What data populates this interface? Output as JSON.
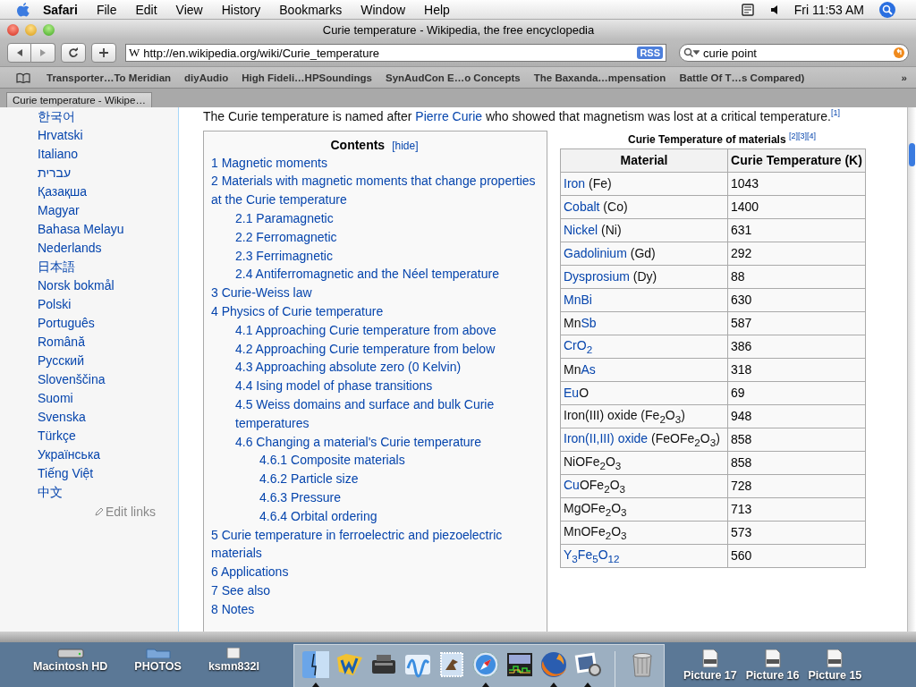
{
  "menubar": {
    "app": "Safari",
    "menus": [
      "File",
      "Edit",
      "View",
      "History",
      "Bookmarks",
      "Window",
      "Help"
    ],
    "clock": "Fri 11:53 AM"
  },
  "window": {
    "title": "Curie temperature - Wikipedia, the free encyclopedia"
  },
  "toolbar": {
    "favicon": "W",
    "url": "http://en.wikipedia.org/wiki/Curie_temperature",
    "rss": "RSS",
    "search": "curie point"
  },
  "bookmarks": {
    "items": [
      "Transporter…To Meridian",
      "diyAudio",
      "High Fideli…HPSoundings",
      "SynAudCon E…o Concepts",
      "The Baxanda…mpensation",
      "Battle Of T…s Compared)"
    ],
    "overflow": "»"
  },
  "tabs": [
    {
      "label": "Curie temperature - Wikipe…",
      "selected": true
    }
  ],
  "sidebar": {
    "languages": [
      "한국어",
      "Hrvatski",
      "Italiano",
      "עברית",
      "Қазақша",
      "Magyar",
      "Bahasa Melayu",
      "Nederlands",
      "日本語",
      "Norsk bokmål",
      "Polski",
      "Português",
      "Română",
      "Русский",
      "Slovenščina",
      "Suomi",
      "Svenska",
      "Türkçe",
      "Українська",
      "Tiếng Việt",
      "中文"
    ],
    "edit_links": "Edit links"
  },
  "intro": {
    "before": "The Curie temperature is named after ",
    "link": "Pierre Curie",
    "after": " who showed that magnetism was lost at a critical temperature.",
    "ref": "[1]"
  },
  "contents": {
    "title": "Contents",
    "toggle": "[hide]",
    "items": [
      {
        "number": "1",
        "label": "Magnetic moments"
      },
      {
        "number": "2",
        "label": "Materials with magnetic moments that change properties at the Curie temperature",
        "children": [
          {
            "number": "2.1",
            "label": "Paramagnetic"
          },
          {
            "number": "2.2",
            "label": "Ferromagnetic"
          },
          {
            "number": "2.3",
            "label": "Ferrimagnetic"
          },
          {
            "number": "2.4",
            "label": "Antiferromagnetic and the Néel temperature"
          }
        ]
      },
      {
        "number": "3",
        "label": "Curie-Weiss law"
      },
      {
        "number": "4",
        "label": "Physics of Curie temperature",
        "children": [
          {
            "number": "4.1",
            "label": "Approaching Curie temperature from above"
          },
          {
            "number": "4.2",
            "label": "Approaching Curie temperature from below"
          },
          {
            "number": "4.3",
            "label": "Approaching absolute zero (0 Kelvin)"
          },
          {
            "number": "4.4",
            "label": "Ising model of phase transitions"
          },
          {
            "number": "4.5",
            "label": "Weiss domains and surface and bulk Curie temperatures"
          },
          {
            "number": "4.6",
            "label": "Changing a material's Curie temperature",
            "children": [
              {
                "number": "4.6.1",
                "label": "Composite materials"
              },
              {
                "number": "4.6.2",
                "label": "Particle size"
              },
              {
                "number": "4.6.3",
                "label": "Pressure"
              },
              {
                "number": "4.6.4",
                "label": "Orbital ordering"
              }
            ]
          }
        ]
      },
      {
        "number": "5",
        "label": "Curie temperature in ferroelectric and piezoelectric materials"
      },
      {
        "number": "6",
        "label": "Applications"
      },
      {
        "number": "7",
        "label": "See also"
      },
      {
        "number": "8",
        "label": "Notes"
      }
    ]
  },
  "table": {
    "caption": "Curie Temperature of materials",
    "caption_refs": "[2][3][4]",
    "columns": [
      "Material",
      "Curie Temperature (K)"
    ],
    "rows": [
      {
        "material": [
          {
            "text": "Iron",
            "link": true
          },
          {
            "text": " (Fe)",
            "link": false
          }
        ],
        "temperature": "1043"
      },
      {
        "material": [
          {
            "text": "Cobalt",
            "link": true
          },
          {
            "text": " (Co)",
            "link": false
          }
        ],
        "temperature": "1400"
      },
      {
        "material": [
          {
            "text": "Nickel",
            "link": true
          },
          {
            "text": " (Ni)",
            "link": false
          }
        ],
        "temperature": "631"
      },
      {
        "material": [
          {
            "text": "Gadolinium",
            "link": true
          },
          {
            "text": " (Gd)",
            "link": false
          }
        ],
        "temperature": "292"
      },
      {
        "material": [
          {
            "text": "Dysprosium",
            "link": true
          },
          {
            "text": " (Dy)",
            "link": false
          }
        ],
        "temperature": "88"
      },
      {
        "material": [
          {
            "text": "MnBi",
            "link": true
          }
        ],
        "temperature": "630"
      },
      {
        "material": [
          {
            "text": "Mn",
            "link": false
          },
          {
            "text": "Sb",
            "link": true
          }
        ],
        "temperature": "587"
      },
      {
        "material": [
          {
            "text": "CrO$_{2}$",
            "link": true
          }
        ],
        "temperature": "386"
      },
      {
        "material": [
          {
            "text": "Mn",
            "link": false
          },
          {
            "text": "As",
            "link": true
          }
        ],
        "temperature": "318"
      },
      {
        "material": [
          {
            "text": "Eu",
            "link": true
          },
          {
            "text": "O",
            "link": false
          }
        ],
        "temperature": "69"
      },
      {
        "material": [
          {
            "text": "Iron(III) oxide (Fe$_{2}$O$_{3}$)",
            "link": false
          }
        ],
        "temperature": "948"
      },
      {
        "material": [
          {
            "text": "Iron(II,III) oxide",
            "link": true
          },
          {
            "text": " (FeOFe$_{2}$O$_{3}$)",
            "link": false
          }
        ],
        "temperature": "858"
      },
      {
        "material": [
          {
            "text": "NiOFe$_{2}$O$_{3}$",
            "link": false
          }
        ],
        "temperature": "858"
      },
      {
        "material": [
          {
            "text": "Cu",
            "link": true
          },
          {
            "text": "OFe$_{2}$O$_{3}$",
            "link": false
          }
        ],
        "temperature": "728"
      },
      {
        "material": [
          {
            "text": "MgOFe$_{2}$O$_{3}$",
            "link": false
          }
        ],
        "temperature": "713"
      },
      {
        "material": [
          {
            "text": "MnOFe$_{2}$O$_{3}$",
            "link": false
          }
        ],
        "temperature": "573"
      },
      {
        "material": [
          {
            "text": "Y$_{3}$Fe$_{5}$O$_{12}$",
            "link": true
          }
        ],
        "temperature": "560"
      }
    ]
  },
  "desktop": {
    "left_icons": [
      {
        "label": "Macintosh HD",
        "kind": "disk"
      },
      {
        "label": "PHOTOS",
        "kind": "folder"
      },
      {
        "label": "ksmn832l",
        "kind": "file"
      }
    ],
    "right_icons": [
      {
        "label": "Picture 17",
        "kind": "png"
      },
      {
        "label": "Picture 16",
        "kind": "png"
      },
      {
        "label": "Picture 15",
        "kind": "png"
      }
    ]
  },
  "dock": [
    {
      "kind": "finder",
      "running": true
    },
    {
      "kind": "w",
      "running": false
    },
    {
      "kind": "printer",
      "running": false
    },
    {
      "kind": "wave",
      "running": false
    },
    {
      "kind": "stamp",
      "running": false
    },
    {
      "kind": "compass",
      "running": true
    },
    {
      "kind": "grid",
      "running": false
    },
    {
      "kind": "globe",
      "running": true
    },
    {
      "kind": "preview",
      "running": true
    },
    {
      "kind": "trash",
      "running": false
    }
  ]
}
